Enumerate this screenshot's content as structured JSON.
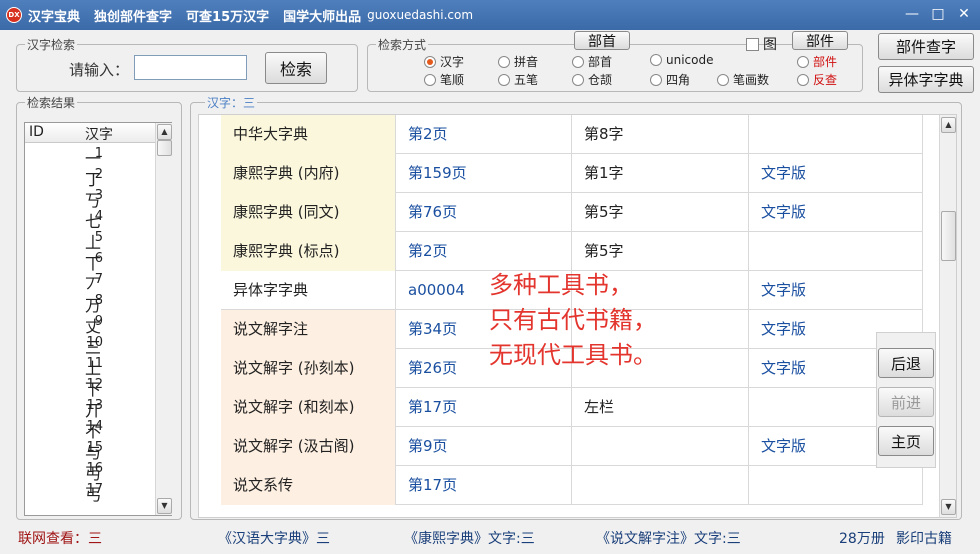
{
  "titlebar": {
    "icon_text": "DX",
    "segments": [
      "汉字宝典",
      "独创部件查字",
      "可查15万汉字",
      "国学大师出品"
    ],
    "url": "guoxuedashi.com",
    "controls": [
      "—",
      "□",
      "✕"
    ]
  },
  "search_group": {
    "label": "汉字检索",
    "input_label": "请输入：",
    "input_value": "",
    "search_button": "检索"
  },
  "method_group": {
    "label": "检索方式",
    "bushou_button": "部首",
    "tu_label": "图",
    "bujian_button": "部件",
    "options_row1": [
      "汉字",
      "拼音",
      "部首",
      "unicode",
      "部件"
    ],
    "options_row2": [
      "笔顺",
      "五笔",
      "仓颉",
      "四角",
      "笔画数",
      "反查"
    ]
  },
  "right_buttons": {
    "bujian_search": "部件查字",
    "variant_dict": "异体字字典"
  },
  "results": {
    "label": "检索结果",
    "col_id": "ID",
    "col_char": "汉字",
    "rows": [
      {
        "id": "1",
        "ch": "一"
      },
      {
        "id": "2",
        "ch": "丁"
      },
      {
        "id": "3",
        "ch": "丂"
      },
      {
        "id": "4",
        "ch": "七"
      },
      {
        "id": "5",
        "ch": "丄"
      },
      {
        "id": "6",
        "ch": "丅"
      },
      {
        "id": "7",
        "ch": "丆"
      },
      {
        "id": "8",
        "ch": "万"
      },
      {
        "id": "9",
        "ch": "丈"
      },
      {
        "id": "10",
        "ch": "三"
      },
      {
        "id": "11",
        "ch": "上"
      },
      {
        "id": "12",
        "ch": "下"
      },
      {
        "id": "13",
        "ch": "丌"
      },
      {
        "id": "14",
        "ch": "不"
      },
      {
        "id": "15",
        "ch": "与"
      },
      {
        "id": "16",
        "ch": "丏"
      },
      {
        "id": "17",
        "ch": "丐"
      }
    ]
  },
  "detail": {
    "label": "汉字：三",
    "rows": [
      {
        "book": "中华大字典",
        "page": "第2页",
        "pos": "第8字",
        "link": ""
      },
      {
        "book": "康熙字典 (内府)",
        "page": "第159页",
        "pos": "第1字",
        "link": "文字版"
      },
      {
        "book": "康熙字典 (同文)",
        "page": "第76页",
        "pos": "第5字",
        "link": "文字版"
      },
      {
        "book": "康熙字典 (标点)",
        "page": "第2页",
        "pos": "第5字",
        "link": ""
      },
      {
        "book": "异体字字典",
        "page": "a00004",
        "pos": "",
        "link": "文字版"
      },
      {
        "book": "说文解字注",
        "page": "第34页",
        "pos": "",
        "link": "文字版"
      },
      {
        "book": "说文解字 (孙刻本)",
        "page": "第26页",
        "pos": "",
        "link": "文字版"
      },
      {
        "book": "说文解字 (和刻本)",
        "page": "第17页",
        "pos": "左栏",
        "link": ""
      },
      {
        "book": "说文解字 (汲古阁)",
        "page": "第9页",
        "pos": "",
        "link": "文字版"
      },
      {
        "book": "说文系传",
        "page": "第17页",
        "pos": "",
        "link": ""
      }
    ],
    "annotation": [
      "多种工具书，",
      "只有古代书籍，",
      "无现代工具书。"
    ]
  },
  "nav": {
    "back": "后退",
    "forward": "前进",
    "home": "主页"
  },
  "status": {
    "online": "联网查看：三",
    "hanyu": "《汉语大字典》三",
    "kangxi": "《康熙字典》文字:三",
    "shuowen": "《说文解字注》文字:三",
    "books": "28万册",
    "ancient": "影印古籍"
  },
  "colors": {
    "title_bg": "#3b6aa8",
    "link_blue": "#1a4fa0",
    "annotation_red": "#e3342d",
    "status_red": "#a01515",
    "row_yellow": "#fbf7dc",
    "row_orange": "#fdefe1"
  }
}
